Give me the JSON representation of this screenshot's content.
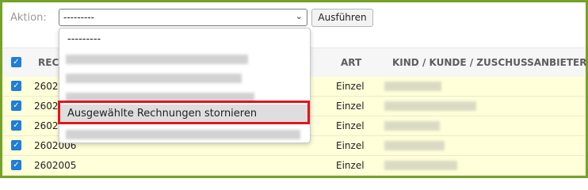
{
  "action": {
    "label": "Aktion:",
    "selected": "---------",
    "run_label": "Ausführen"
  },
  "table": {
    "headers": [
      "REC",
      "ART",
      "KIND / KUNDE / ZUSCHUSSANBIETER"
    ],
    "rows": [
      {
        "id": "2602",
        "art": "Einzel"
      },
      {
        "id": "2602",
        "art": "Einzel"
      },
      {
        "id": "2602",
        "art": "Einzel"
      },
      {
        "id": "2602006",
        "art": "Einzel"
      },
      {
        "id": "2602005",
        "art": "Einzel"
      }
    ]
  },
  "dropdown": {
    "placeholder": "---------",
    "highlighted_option": "Ausgewählte Rechnungen stornieren"
  },
  "colors": {
    "frame": "#76a22a",
    "row_highlight": "#ffffd9",
    "checkbox": "#1f7ed6",
    "callout": "#e0151f"
  }
}
